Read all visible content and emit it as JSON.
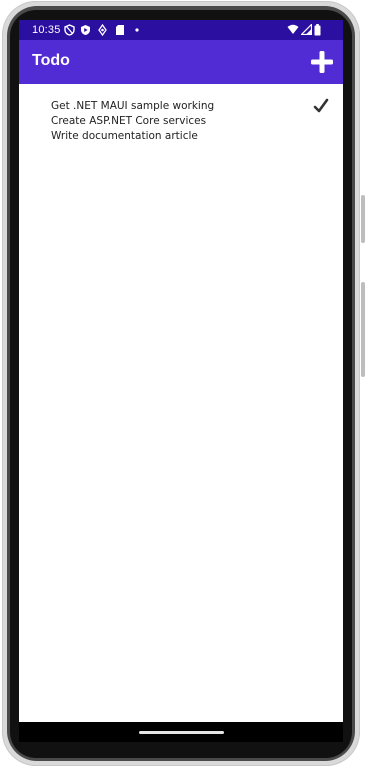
{
  "status_bar": {
    "time": "10:35",
    "icons": [
      "shield-icon",
      "play-protect-icon",
      "location-icon",
      "sd-card-icon",
      "dot-icon",
      "wifi-icon",
      "signal-icon",
      "battery-icon"
    ]
  },
  "app_bar": {
    "title": "Todo",
    "add_icon": "plus-icon"
  },
  "todos": [
    {
      "name": "Get .NET MAUI sample working",
      "done": true
    },
    {
      "name": "Create ASP.NET Core services",
      "done": false
    },
    {
      "name": "Write documentation article",
      "done": false
    }
  ],
  "colors": {
    "status_bar": "#2b0fa0",
    "app_bar": "#512bd4",
    "text": "#222222",
    "nav_bar": "#000000"
  }
}
